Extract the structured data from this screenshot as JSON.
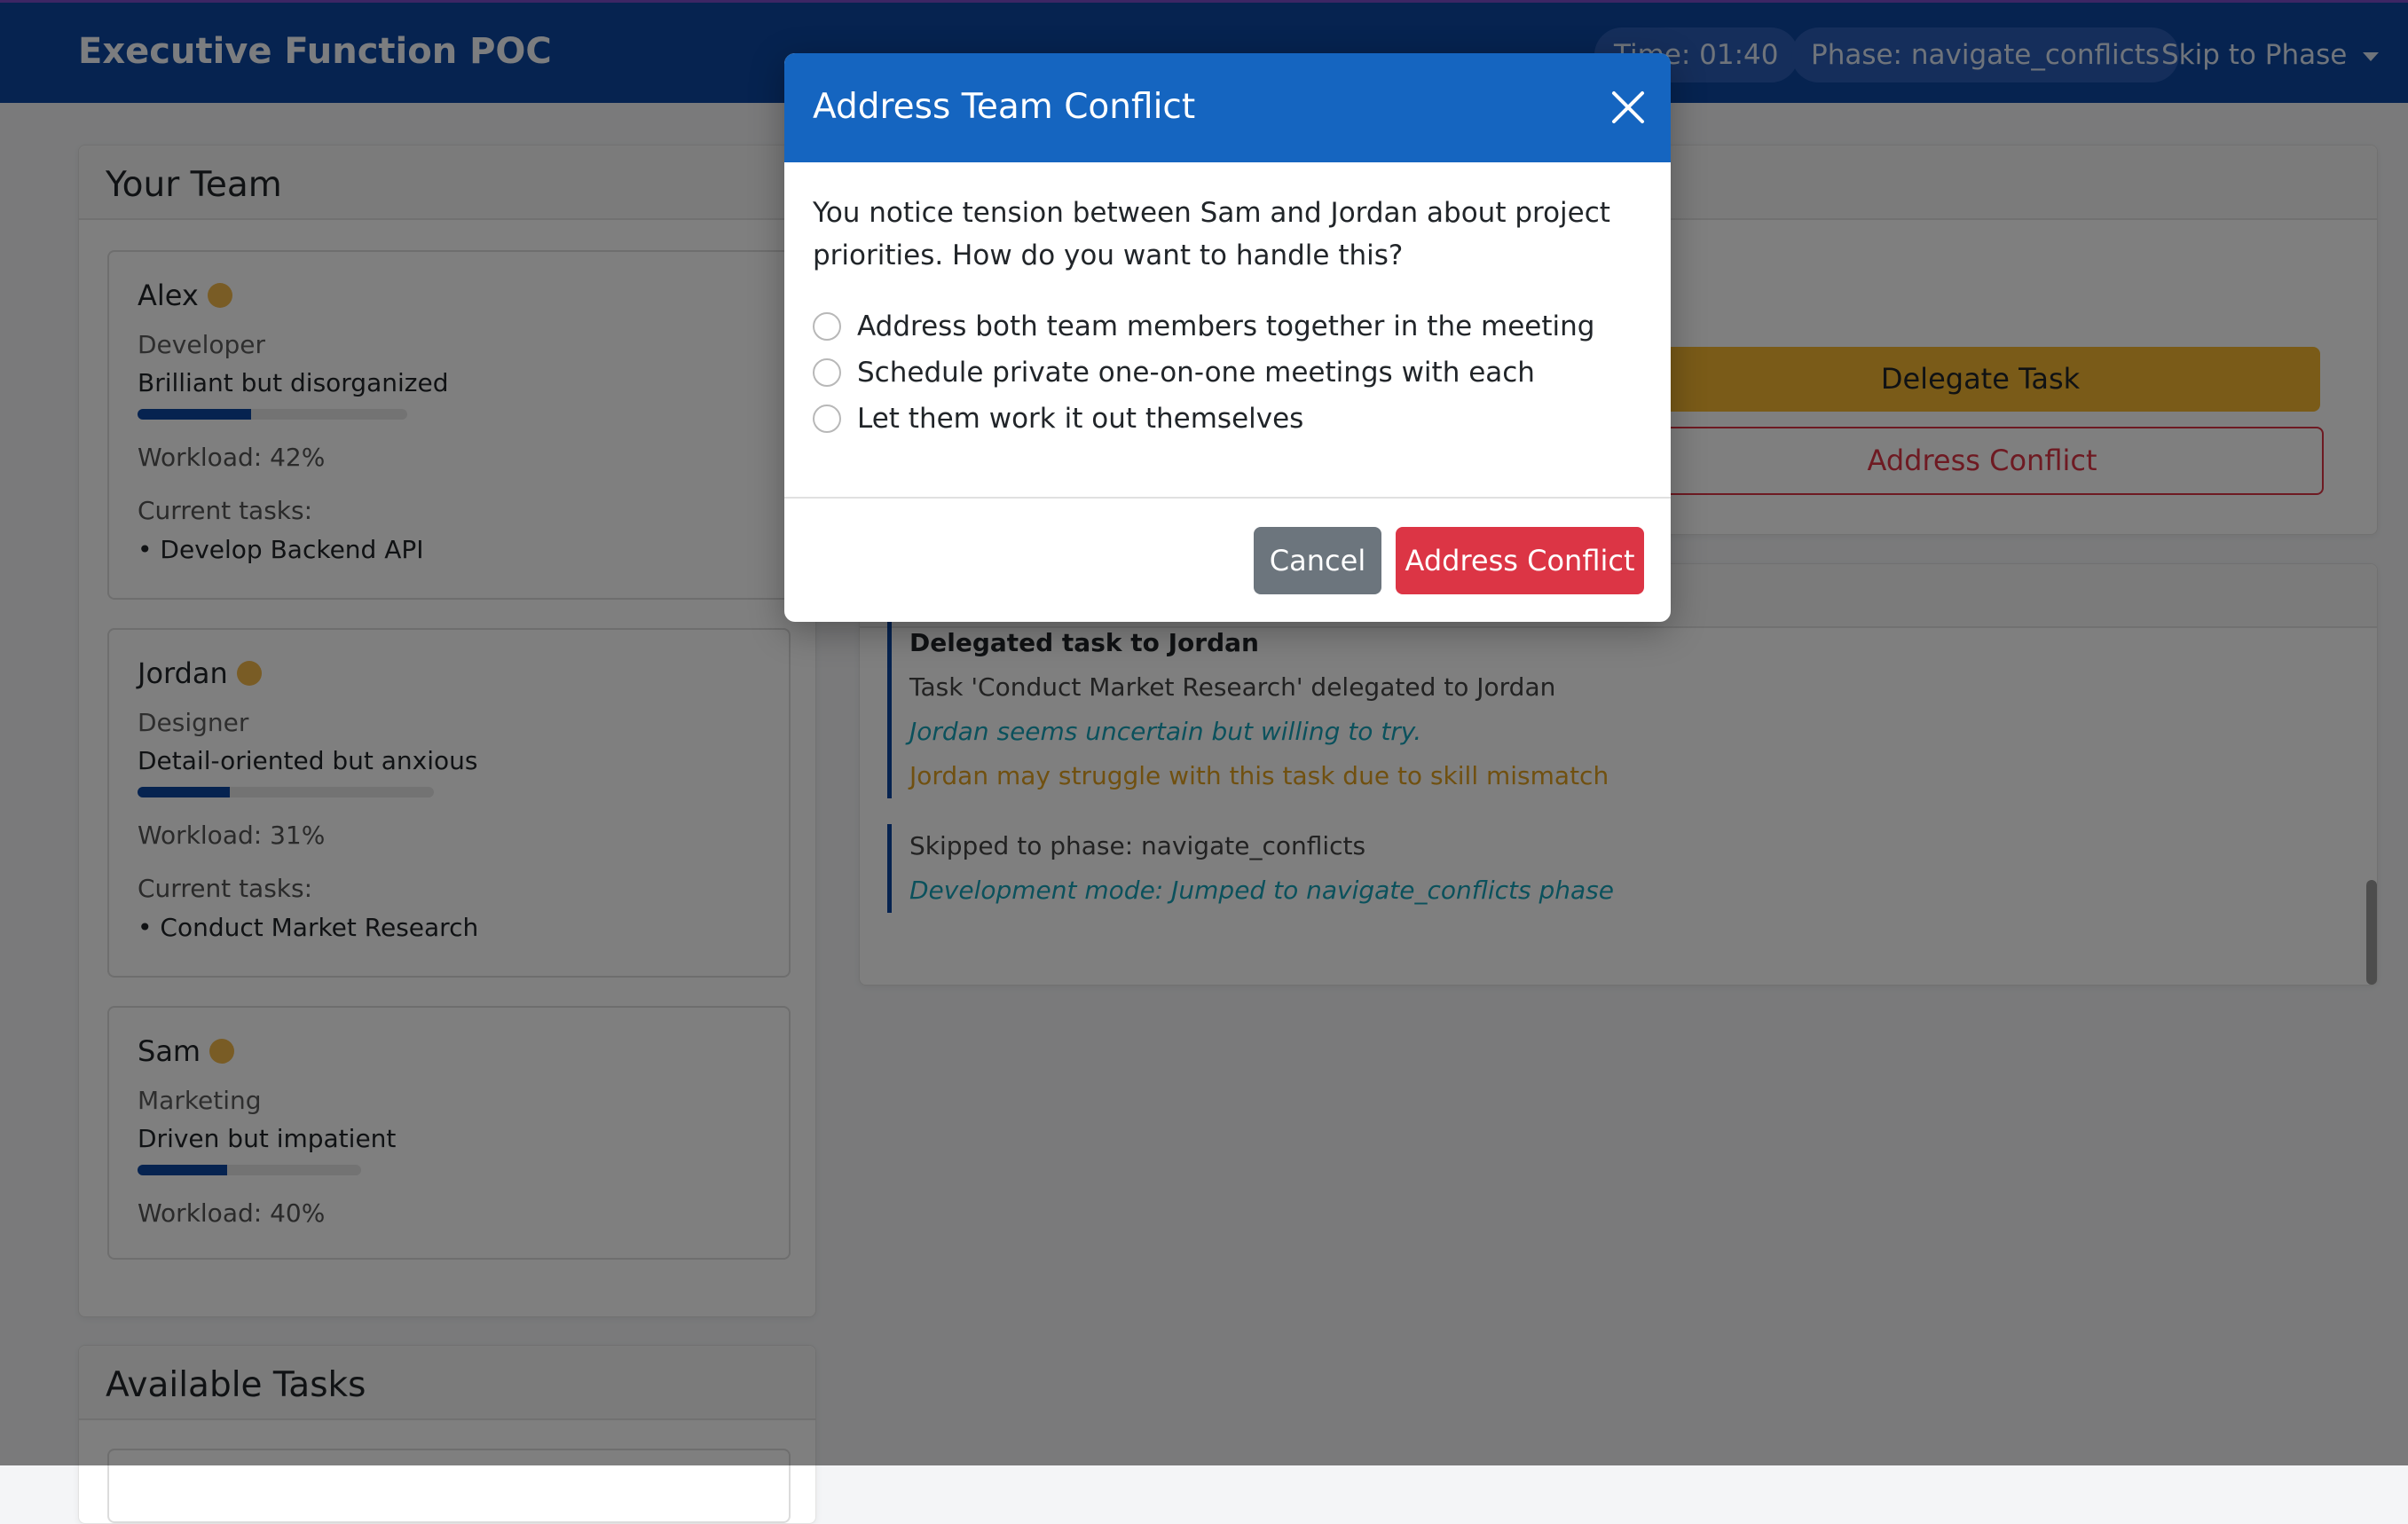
{
  "app": {
    "title": "Executive Function POC",
    "timer": "Time: 01:40",
    "phase": "Phase: navigate_conflicts",
    "skip_label": "Skip to Phase"
  },
  "team": {
    "title": "Your Team",
    "tasks_label": "Current tasks:",
    "members": [
      {
        "name": "Alex",
        "role": "Developer",
        "trait": "Brilliant but disorganized",
        "workload_pct": 42,
        "workload_text": "Workload: 42%",
        "task": "• Develop Backend API"
      },
      {
        "name": "Jordan",
        "role": "Designer",
        "trait": "Detail-oriented but anxious",
        "workload_pct": 31,
        "workload_text": "Workload: 31%",
        "task": "• Conduct Market Research"
      },
      {
        "name": "Sam",
        "role": "Marketing",
        "trait": "Driven but impatient",
        "workload_pct": 40,
        "workload_text": "Workload: 40%"
      }
    ]
  },
  "available_tasks": {
    "title": "Available Tasks"
  },
  "actions": {
    "delegate_label": "Delegate Task",
    "conflict_label": "Address Conflict"
  },
  "log": [
    {
      "title": "Delegated task to Jordan",
      "detail": "Task 'Conduct Market Research' delegated to Jordan",
      "note": "Jordan seems uncertain but willing to try.",
      "warning": "Jordan may struggle with this task due to skill mismatch"
    },
    {
      "detail": "Skipped to phase: navigate_conflicts",
      "note": "Development mode: Jumped to navigate_conflicts phase"
    }
  ],
  "modal": {
    "title": "Address Team Conflict",
    "text": "You notice tension between Sam and Jordan about project priorities. How do you want to handle this?",
    "options": [
      "Address both team members together in the meeting",
      "Schedule private one-on-one meetings with each",
      "Let them work it out themselves"
    ],
    "cancel_label": "Cancel",
    "confirm_label": "Address Conflict"
  },
  "colors": {
    "navbar": "#0d47a1",
    "modal_header": "#1565c0",
    "danger": "#dc3545",
    "warning": "#f5b731",
    "secondary": "#6c757d"
  }
}
